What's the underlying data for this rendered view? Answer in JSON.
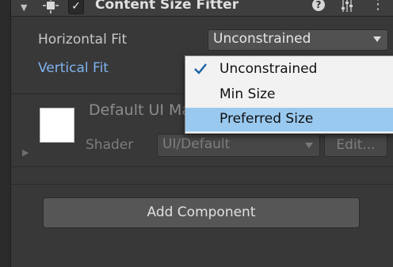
{
  "component": {
    "title": "Content Size Fitter",
    "fold_glyph": "▼",
    "enabled_glyph": "✓",
    "help_glyph": "?",
    "menu_glyph": "⋮"
  },
  "fields": {
    "horizontal_fit": {
      "label": "Horizontal Fit",
      "value": "Unconstrained"
    },
    "vertical_fit": {
      "label": "Vertical Fit"
    }
  },
  "popup": {
    "items": [
      {
        "label": "Unconstrained",
        "checked": true
      },
      {
        "label": "Min Size",
        "checked": false
      },
      {
        "label": "Preferred Size",
        "checked": false,
        "highlighted": true
      }
    ]
  },
  "material": {
    "title": "Default UI Material",
    "shader_label": "Shader",
    "shader_value": "UI/Default",
    "edit_label": "Edit...",
    "foldout_glyph": "▶"
  },
  "add_component_label": "Add Component",
  "colors": {
    "panel_bg": "#383838",
    "accent_label": "#7fb3f0",
    "popup_highlight": "#99c9ef"
  }
}
